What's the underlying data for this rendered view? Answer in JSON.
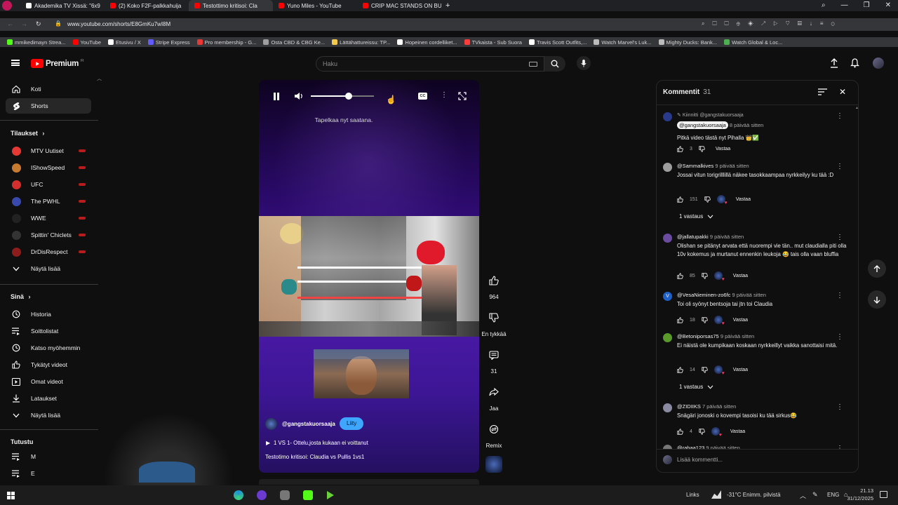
{
  "browser": {
    "tabs": [
      {
        "label": "Akademika TV Xissä: \"6x9",
        "color": "#ffffff"
      },
      {
        "label": "(2) Koko F2F-palkkahuija",
        "color": "#ff0000"
      },
      {
        "label": "Testottimo kritisoi: Cla",
        "color": "#ff0000"
      },
      {
        "label": "Yuno Miles - YouTube",
        "color": "#ff0000"
      },
      {
        "label": "CRIP MAC STANDS ON BU",
        "color": "#ff0000"
      }
    ],
    "url": "www.youtube.com/shorts/E8GmKu7wI8M",
    "bookmarks": [
      {
        "label": "mmikedimayn Strea...",
        "color": "#53fc18"
      },
      {
        "label": "YouTube",
        "color": "#ff0000"
      },
      {
        "label": "Etusivu / X",
        "color": "#ffffff"
      },
      {
        "label": "Stripe Express",
        "color": "#635bff"
      },
      {
        "label": "Pro membership - G...",
        "color": "#e53935"
      },
      {
        "label": "Osta CBD & CBG Ke...",
        "color": "#9e9e9e"
      },
      {
        "label": "Lättähattureissu: TP...",
        "color": "#f2c94c"
      },
      {
        "label": "Hopeinen cordelliket...",
        "color": "#ffffff"
      },
      {
        "label": "TVkaista - Sub Suora",
        "color": "#ff3d3d"
      },
      {
        "label": "Travis Scott Outfits,...",
        "color": "#ffffff"
      },
      {
        "label": "Watch Marvel's Luk...",
        "color": "#bbbbbb"
      },
      {
        "label": "Mighty Ducks: Bank...",
        "color": "#bbbbbb"
      },
      {
        "label": "Watch Global & Loc...",
        "color": "#4caf50"
      }
    ]
  },
  "header": {
    "logo": "Premium",
    "logo_sup": "FI",
    "search_placeholder": "Haku"
  },
  "sidebar": {
    "top": [
      {
        "label": "Koti",
        "icon": "home-icon"
      },
      {
        "label": "Shorts",
        "icon": "shorts-icon"
      }
    ],
    "subs_title": "Tilaukset",
    "subs": [
      {
        "label": "MTV Uutiset",
        "color": "#e53935"
      },
      {
        "label": "IShowSpeed",
        "color": "#c77b30"
      },
      {
        "label": "UFC",
        "color": "#d32f2f"
      },
      {
        "label": "The PWHL",
        "color": "#3949ab"
      },
      {
        "label": "WWE",
        "color": "#222222"
      },
      {
        "label": "Spittin' Chiclets",
        "color": "#333333"
      },
      {
        "label": "DrDisRespect",
        "color": "#8d1c1c"
      }
    ],
    "subs_more": "Näytä lisää",
    "you_title": "Sinä",
    "you": [
      {
        "label": "Historia",
        "icon": "history-icon"
      },
      {
        "label": "Soittolistat",
        "icon": "playlist-icon"
      },
      {
        "label": "Katso myöhemmin",
        "icon": "clock-icon"
      },
      {
        "label": "Tykätyt videot",
        "icon": "like-icon"
      },
      {
        "label": "Omat videot",
        "icon": "video-icon"
      },
      {
        "label": "Lataukset",
        "icon": "download-icon"
      },
      {
        "label": "Näytä lisää",
        "icon": "chevron-down-icon"
      }
    ],
    "explore_title": "Tutustu",
    "explore": [
      {
        "label": "M"
      },
      {
        "label": "E"
      }
    ]
  },
  "player": {
    "caption": "Tapelkaa nyt saatana.",
    "channel": "@gangstakuorsaaja",
    "join_label": "Liity",
    "playlist": "1 VS 1- Ottelu,josta kukaan ei voittanut",
    "title": "Testotimo kritisoi: Claudia vs Pullis 1vs1",
    "volume": 0.6
  },
  "actions": {
    "likes": "964",
    "dislike_label": "En tykkää",
    "comments": "31",
    "share_label": "Jaa",
    "remix_label": "Remix"
  },
  "comments_panel": {
    "title": "Kommentit",
    "count": "31",
    "add_placeholder": "Lisää kommentti...",
    "items": [
      {
        "pinned": "Kiinnitti @gangstakuorsaaja",
        "author": "@gangstakuorsaaja",
        "time": "8 päivää sitten",
        "text": "Pitkä video tästä nyt Pihalla 👑✅",
        "likes": "3",
        "reply": "Vastaa",
        "color": "#2a3a8a"
      },
      {
        "author": "@Sammalkives",
        "time": "9 päivää sitten",
        "text": "Jossai vitun torigrilllillä näkee tasokkaampaa nyrkkeilyy ku tää :D",
        "likes": "151",
        "reply": "Vastaa",
        "color": "#9e9e9e",
        "replies": "1 vastaus"
      },
      {
        "author": "@jallatupakki",
        "time": "9 päivää sitten",
        "text": "Olishan se pitänyt arvata että nuorempi vie tän.. mut claudialla piti olla 10v kokemus ja murtanut ennenkin leukoja 😂 tais olla vaan bluffia",
        "likes": "85",
        "reply": "Vastaa",
        "color": "#6a4ba0"
      },
      {
        "author": "@VesaNieminen-zo6fc",
        "time": "9 päivää sitten",
        "text": "Toi oli syönyt bentsoja tai jtn toi Claudia",
        "likes": "18",
        "reply": "Vastaa",
        "color": "#1e60c8",
        "initial": "V"
      },
      {
        "author": "@Betoniporsas75",
        "time": "9 päivää sitten",
        "text": "Ei näistä ole kumpikaan koskaan nyrkkeillyt vaikka sanottaisi mitä.",
        "likes": "14",
        "reply": "Vastaa",
        "color": "#5a9a2a",
        "replies": "1 vastaus"
      },
      {
        "author": "@ZIDIIKS",
        "time": "7 päivää sitten",
        "text": "Snägäri jonoski o kovempi tasoisi ku tää sirkus😂",
        "likes": "4",
        "reply": "Vastaa",
        "color": "#8a8aa0"
      },
      {
        "author": "@rahaa123",
        "time": "9 päivää sitten",
        "color": "#777777"
      }
    ]
  },
  "taskbar": {
    "links": "Links",
    "weather": "-31°C  Enimm. pilvistä",
    "lang": "ENG",
    "time": "21.13",
    "date": "31/12/2025"
  }
}
